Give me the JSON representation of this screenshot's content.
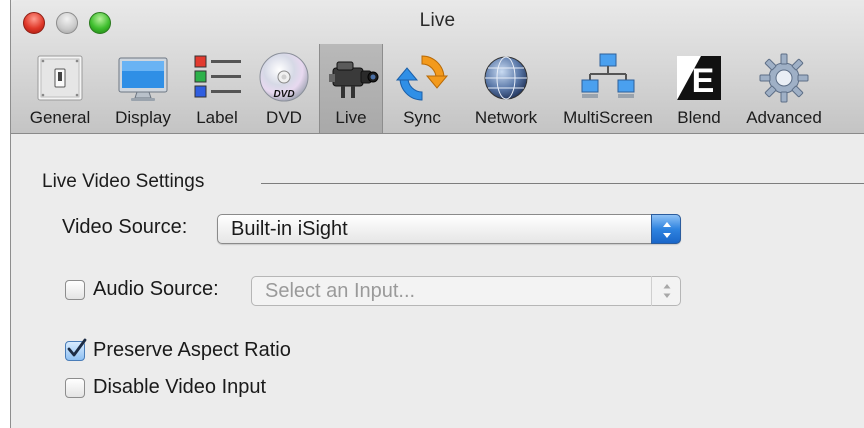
{
  "window": {
    "title": "Live"
  },
  "toolbar": {
    "items": [
      {
        "label": "General",
        "icon": "switch-icon"
      },
      {
        "label": "Display",
        "icon": "monitor-icon"
      },
      {
        "label": "Label",
        "icon": "label-list-icon"
      },
      {
        "label": "DVD",
        "icon": "dvd-disc-icon"
      },
      {
        "label": "Live",
        "icon": "video-camera-icon",
        "selected": true
      },
      {
        "label": "Sync",
        "icon": "sync-arrows-icon"
      },
      {
        "label": "Network",
        "icon": "network-globe-icon"
      },
      {
        "label": "MultiScreen",
        "icon": "multiscreen-icon"
      },
      {
        "label": "Blend",
        "icon": "blend-icon"
      },
      {
        "label": "Advanced",
        "icon": "gear-icon"
      }
    ],
    "dvd_logo_text": "DVD",
    "blend_letter": "E"
  },
  "live_settings": {
    "section_title": "Live Video Settings",
    "video_source": {
      "label": "Video Source:",
      "value": "Built-in iSight"
    },
    "audio_source": {
      "label": "Audio Source:",
      "placeholder": "Select an Input...",
      "checked": false,
      "enabled": false
    },
    "preserve_aspect": {
      "label": "Preserve Aspect Ratio",
      "checked": true
    },
    "disable_video": {
      "label": "Disable Video Input",
      "checked": false
    }
  },
  "colors": {
    "accent": "#2f84e0",
    "close": "#e0392a",
    "zoom": "#3fbf2e"
  }
}
